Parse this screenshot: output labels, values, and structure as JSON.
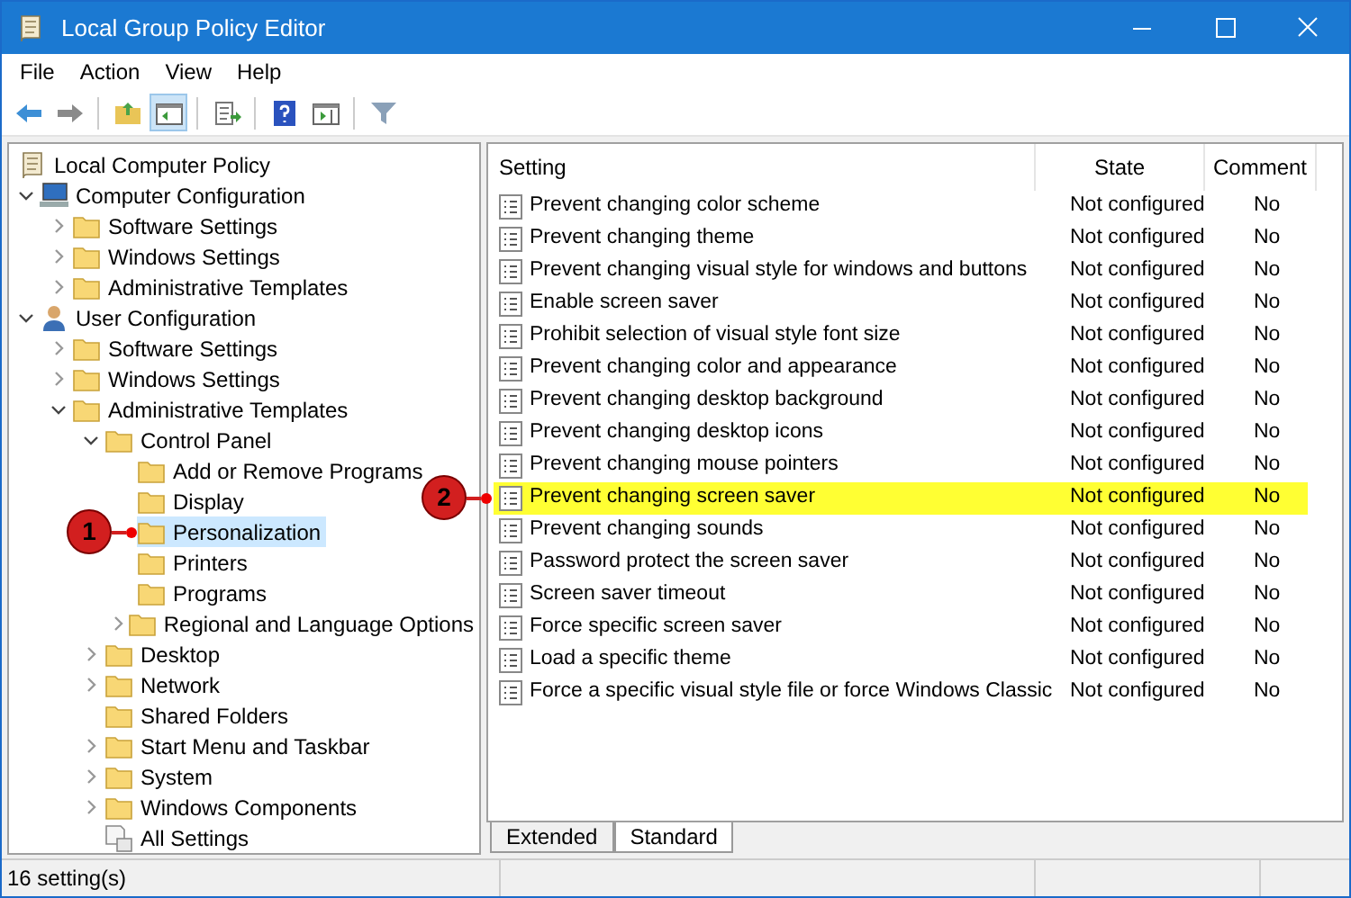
{
  "window": {
    "title": "Local Group Policy Editor"
  },
  "menu": [
    "File",
    "Action",
    "View",
    "Help"
  ],
  "tree": [
    {
      "label": "Local Computer Policy",
      "kind": "policy",
      "selected": false,
      "children": [
        {
          "label": "Computer Configuration",
          "kind": "computer",
          "expanded": true,
          "selected": false,
          "children": [
            {
              "label": "Software Settings",
              "expanded": false,
              "selected": false
            },
            {
              "label": "Windows Settings",
              "expanded": false,
              "selected": false
            },
            {
              "label": "Administrative Templates",
              "expanded": false,
              "selected": false
            }
          ]
        },
        {
          "label": "User Configuration",
          "kind": "user",
          "expanded": true,
          "selected": false,
          "children": [
            {
              "label": "Software Settings",
              "expanded": false,
              "selected": false
            },
            {
              "label": "Windows Settings",
              "expanded": false,
              "selected": false
            },
            {
              "label": "Administrative Templates",
              "expanded": true,
              "selected": false,
              "children": [
                {
                  "label": "Control Panel",
                  "expanded": true,
                  "selected": false,
                  "children": [
                    {
                      "label": "Add or Remove Programs",
                      "selected": false
                    },
                    {
                      "label": "Display",
                      "selected": false
                    },
                    {
                      "label": "Personalization",
                      "selected": true,
                      "callout": "1"
                    },
                    {
                      "label": "Printers",
                      "selected": false
                    },
                    {
                      "label": "Programs",
                      "selected": false
                    },
                    {
                      "label": "Regional and Language Options",
                      "expanded": false,
                      "selected": false
                    }
                  ]
                },
                {
                  "label": "Desktop",
                  "expanded": false,
                  "selected": false
                },
                {
                  "label": "Network",
                  "expanded": false,
                  "selected": false
                },
                {
                  "label": "Shared Folders",
                  "selected": false
                },
                {
                  "label": "Start Menu and Taskbar",
                  "expanded": false,
                  "selected": false
                },
                {
                  "label": "System",
                  "expanded": false,
                  "selected": false
                },
                {
                  "label": "Windows Components",
                  "expanded": false,
                  "selected": false
                },
                {
                  "label": "All Settings",
                  "kind": "settings",
                  "selected": false
                }
              ]
            }
          ]
        }
      ]
    }
  ],
  "table": {
    "columns": [
      "Setting",
      "State",
      "Comment"
    ],
    "rows": [
      {
        "setting": "Prevent changing color scheme",
        "state": "Not configured",
        "comment": "No",
        "highlighted": false
      },
      {
        "setting": "Prevent changing theme",
        "state": "Not configured",
        "comment": "No",
        "highlighted": false
      },
      {
        "setting": "Prevent changing visual style for windows and buttons",
        "state": "Not configured",
        "comment": "No",
        "highlighted": false
      },
      {
        "setting": "Enable screen saver",
        "state": "Not configured",
        "comment": "No",
        "highlighted": false
      },
      {
        "setting": "Prohibit selection of visual style font size",
        "state": "Not configured",
        "comment": "No",
        "highlighted": false
      },
      {
        "setting": "Prevent changing color and appearance",
        "state": "Not configured",
        "comment": "No",
        "highlighted": false
      },
      {
        "setting": "Prevent changing desktop background",
        "state": "Not configured",
        "comment": "No",
        "highlighted": false
      },
      {
        "setting": "Prevent changing desktop icons",
        "state": "Not configured",
        "comment": "No",
        "highlighted": false
      },
      {
        "setting": "Prevent changing mouse pointers",
        "state": "Not configured",
        "comment": "No",
        "highlighted": false
      },
      {
        "setting": "Prevent changing screen saver",
        "state": "Not configured",
        "comment": "No",
        "highlighted": true,
        "callout": "2"
      },
      {
        "setting": "Prevent changing sounds",
        "state": "Not configured",
        "comment": "No",
        "highlighted": false
      },
      {
        "setting": "Password protect the screen saver",
        "state": "Not configured",
        "comment": "No",
        "highlighted": false
      },
      {
        "setting": "Screen saver timeout",
        "state": "Not configured",
        "comment": "No",
        "highlighted": false
      },
      {
        "setting": "Force specific screen saver",
        "state": "Not configured",
        "comment": "No",
        "highlighted": false
      },
      {
        "setting": "Load a specific theme",
        "state": "Not configured",
        "comment": "No",
        "highlighted": false
      },
      {
        "setting": "Force a specific visual style file or force Windows Classic",
        "state": "Not configured",
        "comment": "No",
        "highlighted": false
      }
    ]
  },
  "view_tabs": [
    {
      "label": "Extended",
      "selected": false
    },
    {
      "label": "Standard",
      "selected": true
    }
  ],
  "status_bar": "16 setting(s)"
}
